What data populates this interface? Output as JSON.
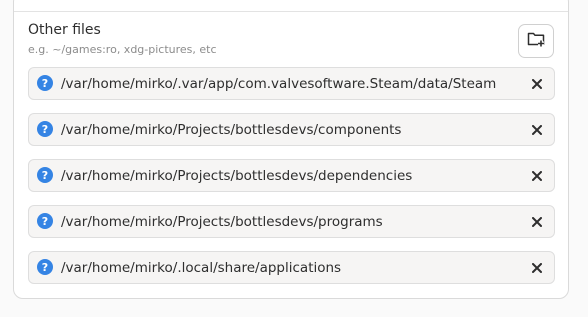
{
  "section": {
    "title": "Other files",
    "subtitle": "e.g. ~/games:ro, xdg-pictures, etc",
    "add_icon": "folder-add-icon"
  },
  "entries": [
    {
      "path": "/var/home/mirko/.var/app/com.valvesoftware.Steam/data/Steam",
      "icon": "question-icon",
      "remove_icon": "close-icon"
    },
    {
      "path": "/var/home/mirko/Projects/bottlesdevs/components",
      "icon": "question-icon",
      "remove_icon": "close-icon"
    },
    {
      "path": "/var/home/mirko/Projects/bottlesdevs/dependencies",
      "icon": "question-icon",
      "remove_icon": "close-icon"
    },
    {
      "path": "/var/home/mirko/Projects/bottlesdevs/programs",
      "icon": "question-icon",
      "remove_icon": "close-icon"
    },
    {
      "path": "/var/home/mirko/.local/share/applications",
      "icon": "question-icon",
      "remove_icon": "close-icon"
    }
  ],
  "colors": {
    "accent": "#3584e4",
    "row_bg": "#f6f5f4"
  }
}
